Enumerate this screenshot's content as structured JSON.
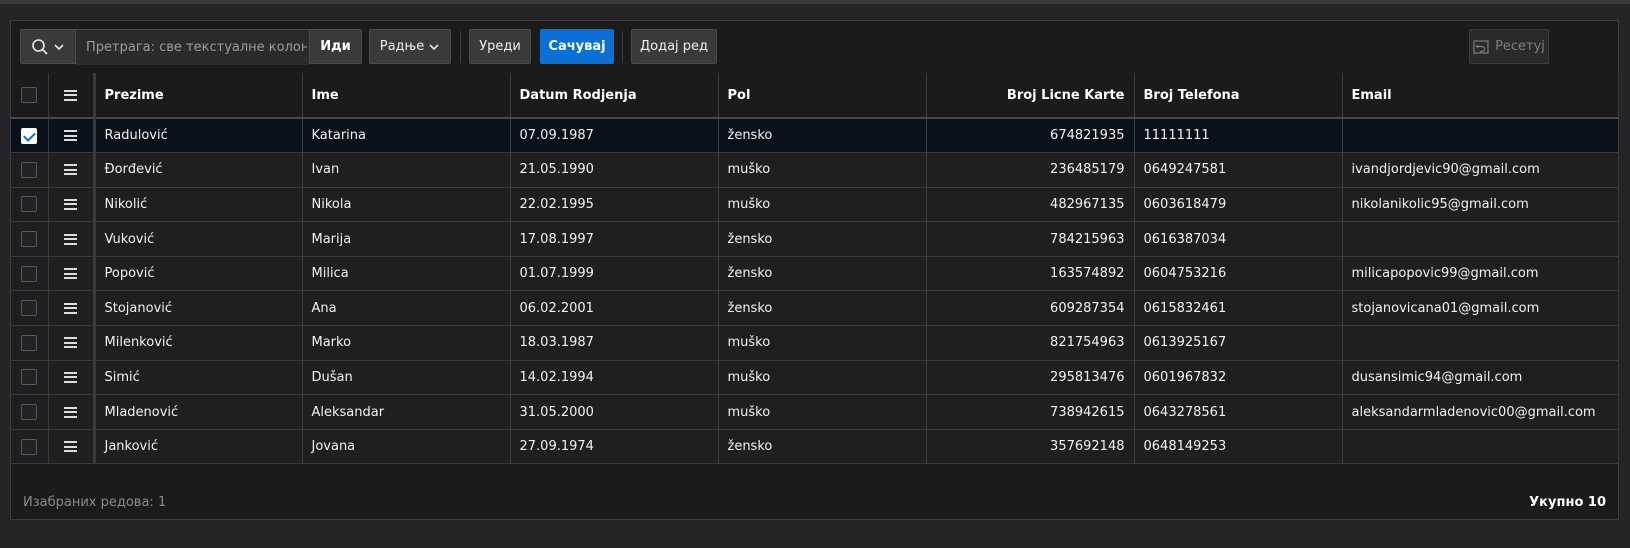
{
  "toolbar": {
    "search_placeholder": "Претрага: све текстуалне колоне",
    "go_label": "Иди",
    "actions_label": "Радње",
    "edit_label": "Уреди",
    "save_label": "Сачувај",
    "add_row_label": "Додај ред",
    "reset_label": "Ресетуј"
  },
  "columns": [
    "Prezime",
    "Ime",
    "Datum Rodjenja",
    "Pol",
    "Broj Licne Karte",
    "Broj Telefona",
    "Email"
  ],
  "rows": [
    {
      "prezime": "Radulović",
      "ime": "Katarina",
      "datum": "07.09.1987",
      "pol": "žensko",
      "lk": "674821935",
      "tel": "11111111",
      "email": "",
      "selected": true
    },
    {
      "prezime": "Đorđević",
      "ime": "Ivan",
      "datum": "21.05.1990",
      "pol": "muško",
      "lk": "236485179",
      "tel": "0649247581",
      "email": "ivandjordjevic90@gmail.com",
      "selected": false
    },
    {
      "prezime": "Nikolić",
      "ime": "Nikola",
      "datum": "22.02.1995",
      "pol": "muško",
      "lk": "482967135",
      "tel": "0603618479",
      "email": "nikolanikolic95@gmail.com",
      "selected": false
    },
    {
      "prezime": "Vuković",
      "ime": "Marija",
      "datum": "17.08.1997",
      "pol": "žensko",
      "lk": "784215963",
      "tel": "0616387034",
      "email": "",
      "selected": false
    },
    {
      "prezime": "Popović",
      "ime": "Milica",
      "datum": "01.07.1999",
      "pol": "žensko",
      "lk": "163574892",
      "tel": "0604753216",
      "email": "milicapopovic99@gmail.com",
      "selected": false
    },
    {
      "prezime": "Stojanović",
      "ime": "Ana",
      "datum": "06.02.2001",
      "pol": "žensko",
      "lk": "609287354",
      "tel": "0615832461",
      "email": "stojanovicana01@gmail.com",
      "selected": false
    },
    {
      "prezime": "Milenković",
      "ime": "Marko",
      "datum": "18.03.1987",
      "pol": "muško",
      "lk": "821754963",
      "tel": "0613925167",
      "email": "",
      "selected": false
    },
    {
      "prezime": "Simić",
      "ime": "Dušan",
      "datum": "14.02.1994",
      "pol": "muško",
      "lk": "295813476",
      "tel": "0601967832",
      "email": "dusansimic94@gmail.com",
      "selected": false
    },
    {
      "prezime": "Mladenović",
      "ime": "Aleksandar",
      "datum": "31.05.2000",
      "pol": "muško",
      "lk": "738942615",
      "tel": "0643278561",
      "email": "aleksandarmladenovic00@gmail.com",
      "selected": false
    },
    {
      "prezime": "Janković",
      "ime": "Jovana",
      "datum": "27.09.1974",
      "pol": "žensko",
      "lk": "357692148",
      "tel": "0648149253",
      "email": "",
      "selected": false
    }
  ],
  "footer": {
    "selected_rows": "Изабраних редова: 1",
    "total": "Укупно 10"
  },
  "colors": {
    "primary": "#0b6fd6",
    "background": "#1b1b1d",
    "selected_row": "#0b111b"
  }
}
